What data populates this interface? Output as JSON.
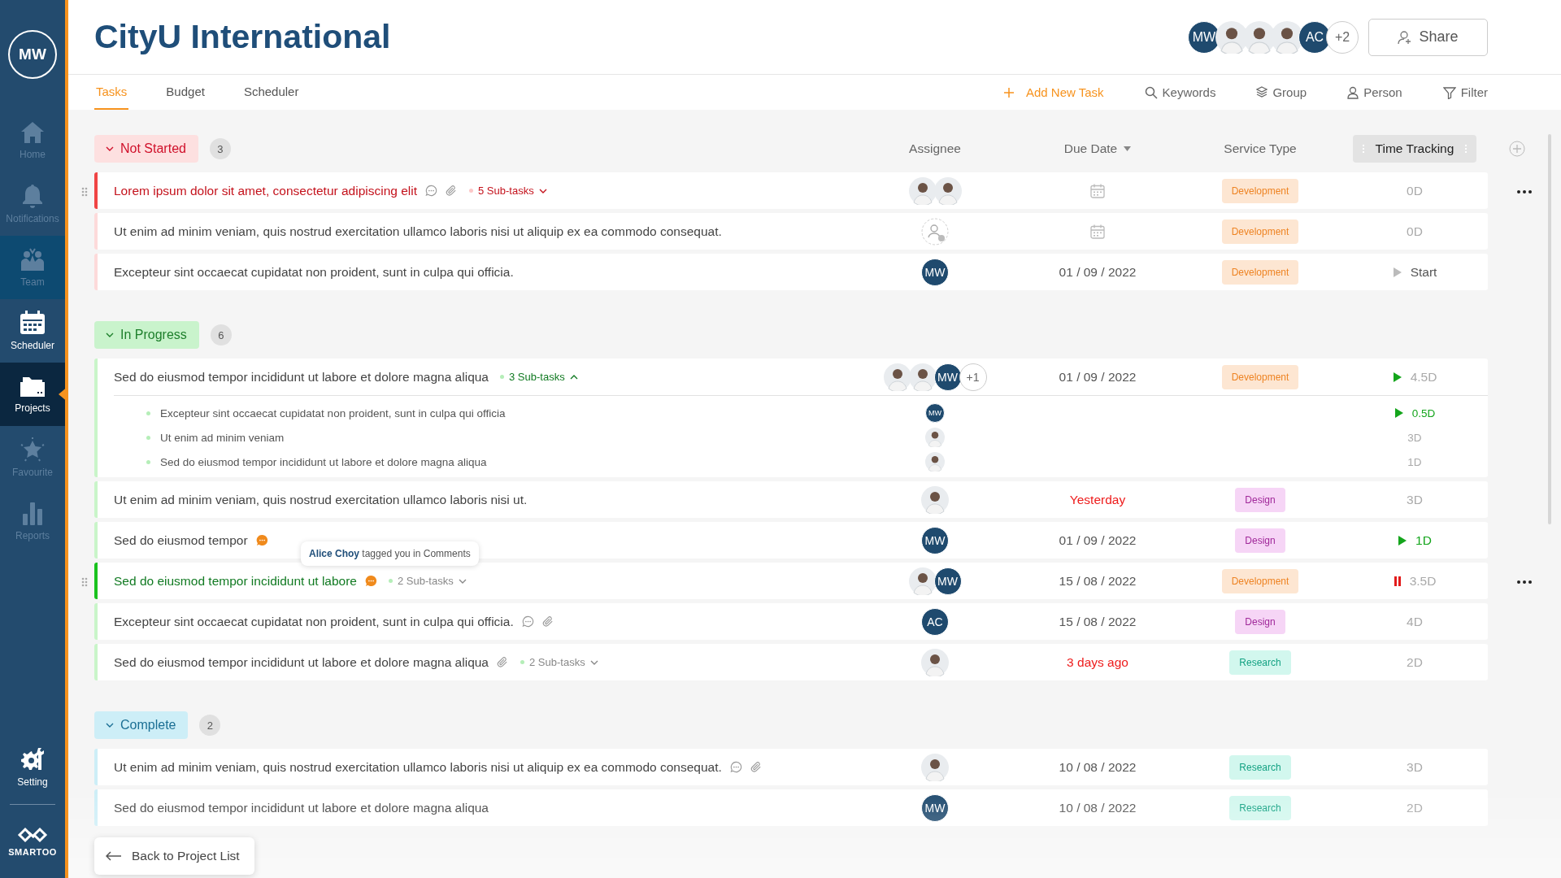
{
  "sidebar": {
    "user_initials": "MW",
    "items": [
      {
        "label": "Home",
        "kind": "home",
        "selected": false,
        "disabled": true,
        "hovered": false
      },
      {
        "label": "Notifications",
        "kind": "notifications",
        "selected": false,
        "disabled": true,
        "hovered": false
      },
      {
        "label": "Team",
        "kind": "team",
        "selected": false,
        "disabled": true,
        "hovered": true
      },
      {
        "label": "Scheduler",
        "kind": "scheduler",
        "selected": false,
        "disabled": false,
        "hovered": false
      },
      {
        "label": "Projects",
        "kind": "projects",
        "selected": true,
        "disabled": false,
        "hovered": false
      },
      {
        "label": "Favourite",
        "kind": "favourite",
        "selected": false,
        "disabled": true,
        "hovered": false
      },
      {
        "label": "Reports",
        "kind": "reports",
        "selected": false,
        "disabled": true,
        "hovered": false
      }
    ],
    "setting": {
      "label": "Setting"
    },
    "logo": "SMARTOO"
  },
  "header": {
    "title": "CityU International",
    "members": [
      {
        "kind": "initials",
        "text": "MW"
      },
      {
        "kind": "photo"
      },
      {
        "kind": "photo"
      },
      {
        "kind": "photo"
      },
      {
        "kind": "initials",
        "text": "AC"
      },
      {
        "kind": "more",
        "text": "+2"
      }
    ],
    "share": "Share"
  },
  "tabs": [
    {
      "label": "Tasks",
      "selected": true
    },
    {
      "label": "Budget",
      "selected": false
    },
    {
      "label": "Scheduler",
      "selected": false
    }
  ],
  "toolbar": [
    {
      "kind": "add",
      "label": "Add New Task"
    },
    {
      "kind": "search",
      "label": "Keywords"
    },
    {
      "kind": "group",
      "label": "Group"
    },
    {
      "kind": "person",
      "label": "Person"
    },
    {
      "kind": "filter",
      "label": "Filter"
    }
  ],
  "columns": [
    {
      "label": "Assignee",
      "sortable": false,
      "highlighted": false
    },
    {
      "label": "Due Date",
      "sortable": true,
      "highlighted": false
    },
    {
      "label": "Service Type",
      "sortable": false,
      "highlighted": false
    },
    {
      "label": "Time Tracking",
      "sortable": false,
      "highlighted": true
    }
  ],
  "groups": [
    {
      "label": "Not Started",
      "kind": "not_started",
      "count": "3",
      "expanded": true,
      "tasks": [
        {
          "title": "Lorem ipsum dolor sit amet, consectetur adipiscing elit",
          "highlighted": true,
          "comment": {
            "kind": "read"
          },
          "attachment": true,
          "subtasks": {
            "label": "5 Sub-tasks",
            "expanded": false,
            "active": true
          },
          "assignees": [
            {
              "kind": "photo"
            },
            {
              "kind": "photo"
            }
          ],
          "service": {
            "label": "Development",
            "kind": "development"
          },
          "time": {
            "text": "0D",
            "kind": "idle"
          }
        },
        {
          "title": "Ut enim ad minim veniam, quis nostrud exercitation ullamco laboris nisi ut aliquip ex ea commodo consequat.",
          "highlighted": false,
          "attachment": false,
          "assignees": [
            {
              "kind": "empty"
            }
          ],
          "service": {
            "label": "Development",
            "kind": "development"
          },
          "time": {
            "text": "0D",
            "kind": "idle"
          }
        },
        {
          "title": "Excepteur sint occaecat cupidatat non proident, sunt in culpa qui officia.",
          "highlighted": false,
          "attachment": false,
          "assignees": [
            {
              "kind": "initials",
              "text": "MW"
            }
          ],
          "due": {
            "text": "01 / 09 / 2022",
            "overdue": false
          },
          "service": {
            "label": "Development",
            "kind": "development"
          },
          "time": {
            "text": "Start",
            "kind": "start"
          }
        }
      ]
    },
    {
      "label": "In Progress",
      "kind": "in_progress",
      "count": "6",
      "expanded": true,
      "tasks": [
        {
          "title": "Sed do eiusmod tempor incididunt ut labore et dolore magna aliqua",
          "highlighted": false,
          "attachment": false,
          "subtasks": {
            "label": "3 Sub-tasks",
            "expanded": true,
            "active": true
          },
          "assignees": [
            {
              "kind": "photo"
            },
            {
              "kind": "photo"
            },
            {
              "kind": "initials",
              "text": "MW"
            },
            {
              "kind": "more",
              "text": "+1"
            }
          ],
          "due": {
            "text": "01 / 09 / 2022",
            "overdue": false
          },
          "service": {
            "label": "Development",
            "kind": "development"
          },
          "time": {
            "text": "4.5D",
            "kind": "tracking"
          },
          "subtask_items": [
            {
              "title": "Excepteur sint occaecat cupidatat non proident, sunt in culpa qui officia",
              "assignee": {
                "kind": "initials",
                "text": "MW"
              },
              "time": {
                "text": "0.5D",
                "kind": "running"
              }
            },
            {
              "title": "Ut enim ad minim veniam",
              "assignee": {
                "kind": "photo"
              },
              "time": {
                "text": "3D",
                "kind": "idle"
              }
            },
            {
              "title": "Sed do eiusmod tempor incididunt ut labore et dolore magna aliqua",
              "assignee": {
                "kind": "photo"
              },
              "time": {
                "text": "1D",
                "kind": "idle"
              }
            }
          ]
        },
        {
          "title": "Ut enim ad minim veniam, quis nostrud exercitation ullamco laboris nisi ut.",
          "highlighted": false,
          "attachment": false,
          "assignees": [
            {
              "kind": "photo"
            }
          ],
          "due": {
            "text": "Yesterday",
            "overdue": true
          },
          "service": {
            "label": "Design",
            "kind": "design"
          },
          "time": {
            "text": "3D",
            "kind": "idle"
          }
        },
        {
          "title": "Sed do eiusmod tempor",
          "highlighted": false,
          "comment": {
            "kind": "unread"
          },
          "attachment": false,
          "assignees": [
            {
              "kind": "initials",
              "text": "MW"
            }
          ],
          "due": {
            "text": "01 / 09 / 2022",
            "overdue": false
          },
          "service": {
            "label": "Design",
            "kind": "design"
          },
          "time": {
            "text": "1D",
            "kind": "running"
          }
        },
        {
          "title": "Sed do eiusmod tempor incididunt ut labore",
          "highlighted": true,
          "comment": {
            "kind": "unread"
          },
          "tooltip": "**Alice Choy** tagged you in Comments",
          "attachment": false,
          "subtasks": {
            "label": "2 Sub-tasks",
            "expanded": false,
            "active": false
          },
          "assignees": [
            {
              "kind": "photo"
            },
            {
              "kind": "initials",
              "text": "MW"
            }
          ],
          "due": {
            "text": "15 / 08 / 2022",
            "overdue": false
          },
          "service": {
            "label": "Development",
            "kind": "development"
          },
          "time": {
            "text": "3.5D",
            "kind": "paused"
          }
        },
        {
          "title": "Excepteur sint occaecat cupidatat non proident, sunt in culpa qui officia.",
          "highlighted": false,
          "comment": {
            "kind": "read"
          },
          "attachment": true,
          "assignees": [
            {
              "kind": "initials",
              "text": "AC"
            }
          ],
          "due": {
            "text": "15 / 08 / 2022",
            "overdue": false
          },
          "service": {
            "label": "Design",
            "kind": "design"
          },
          "time": {
            "text": "4D",
            "kind": "idle"
          }
        },
        {
          "title": "Sed do eiusmod tempor incididunt ut labore et dolore magna aliqua",
          "highlighted": false,
          "attachment": true,
          "subtasks": {
            "label": "2 Sub-tasks",
            "expanded": false,
            "active": false
          },
          "assignees": [
            {
              "kind": "photo"
            }
          ],
          "due": {
            "text": "3 days ago",
            "overdue": true
          },
          "service": {
            "label": "Research",
            "kind": "research"
          },
          "time": {
            "text": "2D",
            "kind": "idle"
          }
        }
      ]
    },
    {
      "label": "Complete",
      "kind": "complete",
      "count": "2",
      "expanded": true,
      "tasks": [
        {
          "title": "Ut enim ad minim veniam, quis nostrud exercitation ullamco laboris nisi ut aliquip ex ea commodo consequat.",
          "highlighted": false,
          "comment": {
            "kind": "read"
          },
          "attachment": true,
          "assignees": [
            {
              "kind": "photo"
            }
          ],
          "due": {
            "text": "10 / 08 / 2022",
            "overdue": false
          },
          "service": {
            "label": "Research",
            "kind": "research"
          },
          "time": {
            "text": "3D",
            "kind": "idle"
          }
        },
        {
          "title": "Sed do eiusmod tempor incididunt ut labore et dolore magna aliqua",
          "highlighted": false,
          "attachment": false,
          "assignees": [
            {
              "kind": "initials",
              "text": "MW"
            }
          ],
          "due": {
            "text": "10 / 08 / 2022",
            "overdue": false
          },
          "service": {
            "label": "Research",
            "kind": "research"
          },
          "time": {
            "text": "2D",
            "kind": "idle"
          }
        }
      ]
    }
  ],
  "back_button": "Back to Project List"
}
